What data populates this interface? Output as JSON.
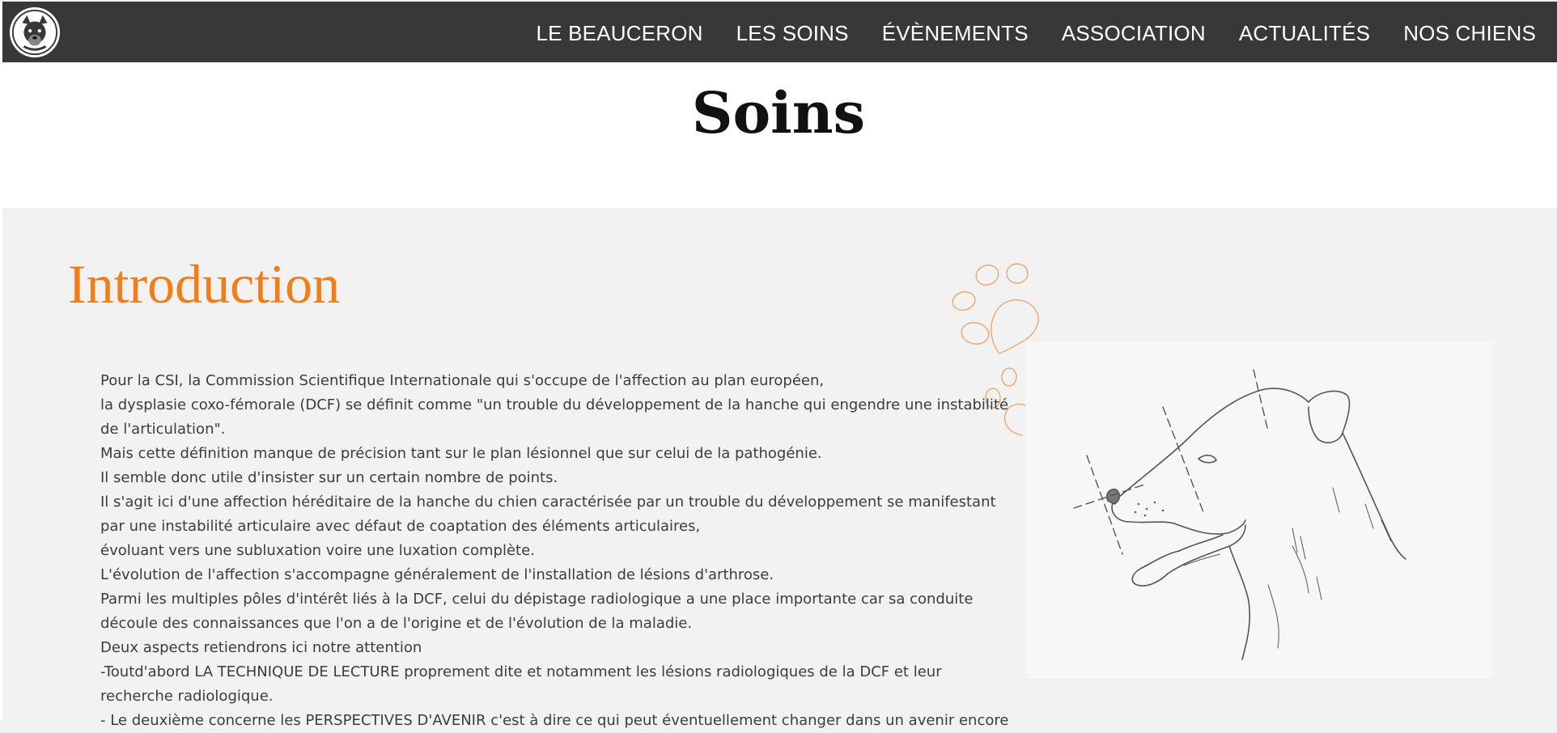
{
  "header": {
    "logo_icon": "beauceron-dog-logo-icon",
    "nav": [
      {
        "label": "LE BEAUCERON"
      },
      {
        "label": "LES SOINS"
      },
      {
        "label": "ÉVÈNEMENTS"
      },
      {
        "label": "ASSOCIATION"
      },
      {
        "label": "ACTUALITÉS"
      },
      {
        "label": "NOS CHIENS"
      }
    ]
  },
  "page": {
    "title": "Soins"
  },
  "section": {
    "heading": "Introduction",
    "accent_color": "#f07f1a",
    "decoration_icon": "paw-print-icon",
    "image_icon": "dog-head-sketch",
    "paragraphs": [
      "Pour la CSI, la Commission Scientifique Internationale qui s'occupe de l'affection au plan européen,",
      "la dysplasie coxo-fémorale (DCF) se définit comme \"un trouble du développement de la hanche qui engendre une instabilité",
      "de l'articulation\".",
      "Mais cette définition manque de précision tant sur le plan lésionnel que sur celui de la pathogénie.",
      "Il semble donc utile d'insister sur un certain nombre de points.",
      "Il s'agit ici d'une affection héréditaire de la hanche du chien caractérisée par un trouble du développement se manifestant",
      "par une instabilité articulaire avec défaut de coaptation des éléments articulaires,",
      "évoluant vers une subluxation voire une luxation complète.",
      "L'évolution de l'affection s'accompagne généralement de l'installation de lésions d'arthrose.",
      "Parmi les multiples pôles d'intérêt liés à la DCF, celui du dépistage radiologique a une place importante car sa conduite",
      "découle des connaissances que l'on a de l'origine et de l'évolution de la maladie.",
      "Deux aspects retiendrons ici notre attention",
      "-Toutd'abord LA TECHNIQUE DE LECTURE proprement dite et notamment les lésions radiologiques de la DCF et leur",
      "recherche radiologique.",
      "- Le deuxième concerne les PERSPECTIVES D'AVENIR c'est à dire ce qui peut éventuellement changer dans un avenir encore"
    ]
  }
}
